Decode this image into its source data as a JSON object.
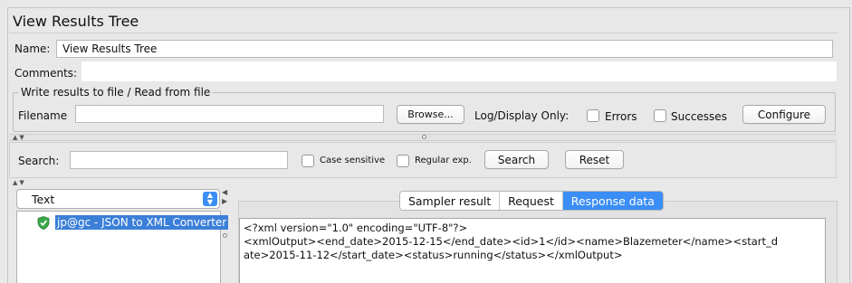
{
  "panel": {
    "title": "View Results Tree",
    "name_label": "Name:",
    "name_value": "View Results Tree",
    "comments_label": "Comments:"
  },
  "file_group": {
    "legend": "Write results to file / Read from file",
    "filename_label": "Filename",
    "filename_value": "",
    "browse_label": "Browse...",
    "log_display_label": "Log/Display Only:",
    "errors_label": "Errors",
    "successes_label": "Successes",
    "configure_label": "Configure",
    "errors_checked": false,
    "successes_checked": false
  },
  "search_bar": {
    "label": "Search:",
    "value": "",
    "case_sensitive_label": "Case sensitive",
    "regular_exp_label": "Regular exp.",
    "search_button": "Search",
    "reset_button": "Reset"
  },
  "renderer": {
    "selected": "Text"
  },
  "tree": {
    "items": [
      {
        "label": "jp@gc - JSON to XML Converter",
        "status": "success",
        "selected": true
      }
    ]
  },
  "tabs": [
    {
      "label": "Sampler result",
      "active": false
    },
    {
      "label": "Request",
      "active": false
    },
    {
      "label": "Response data",
      "active": true
    }
  ],
  "response": {
    "lines": [
      "<?xml version=\"1.0\" encoding=\"UTF-8\"?>",
      "<xmlOutput><end_date>2015-12-15</end_date><id>1</id><name>Blazemeter</name><start_d",
      "ate>2015-11-12</start_date><status>running</status></xmlOutput>"
    ]
  },
  "colors": {
    "selection_blue": "#3b7fd8",
    "tab_active": "#3b8ef5",
    "success_green": "#3aa64a"
  }
}
